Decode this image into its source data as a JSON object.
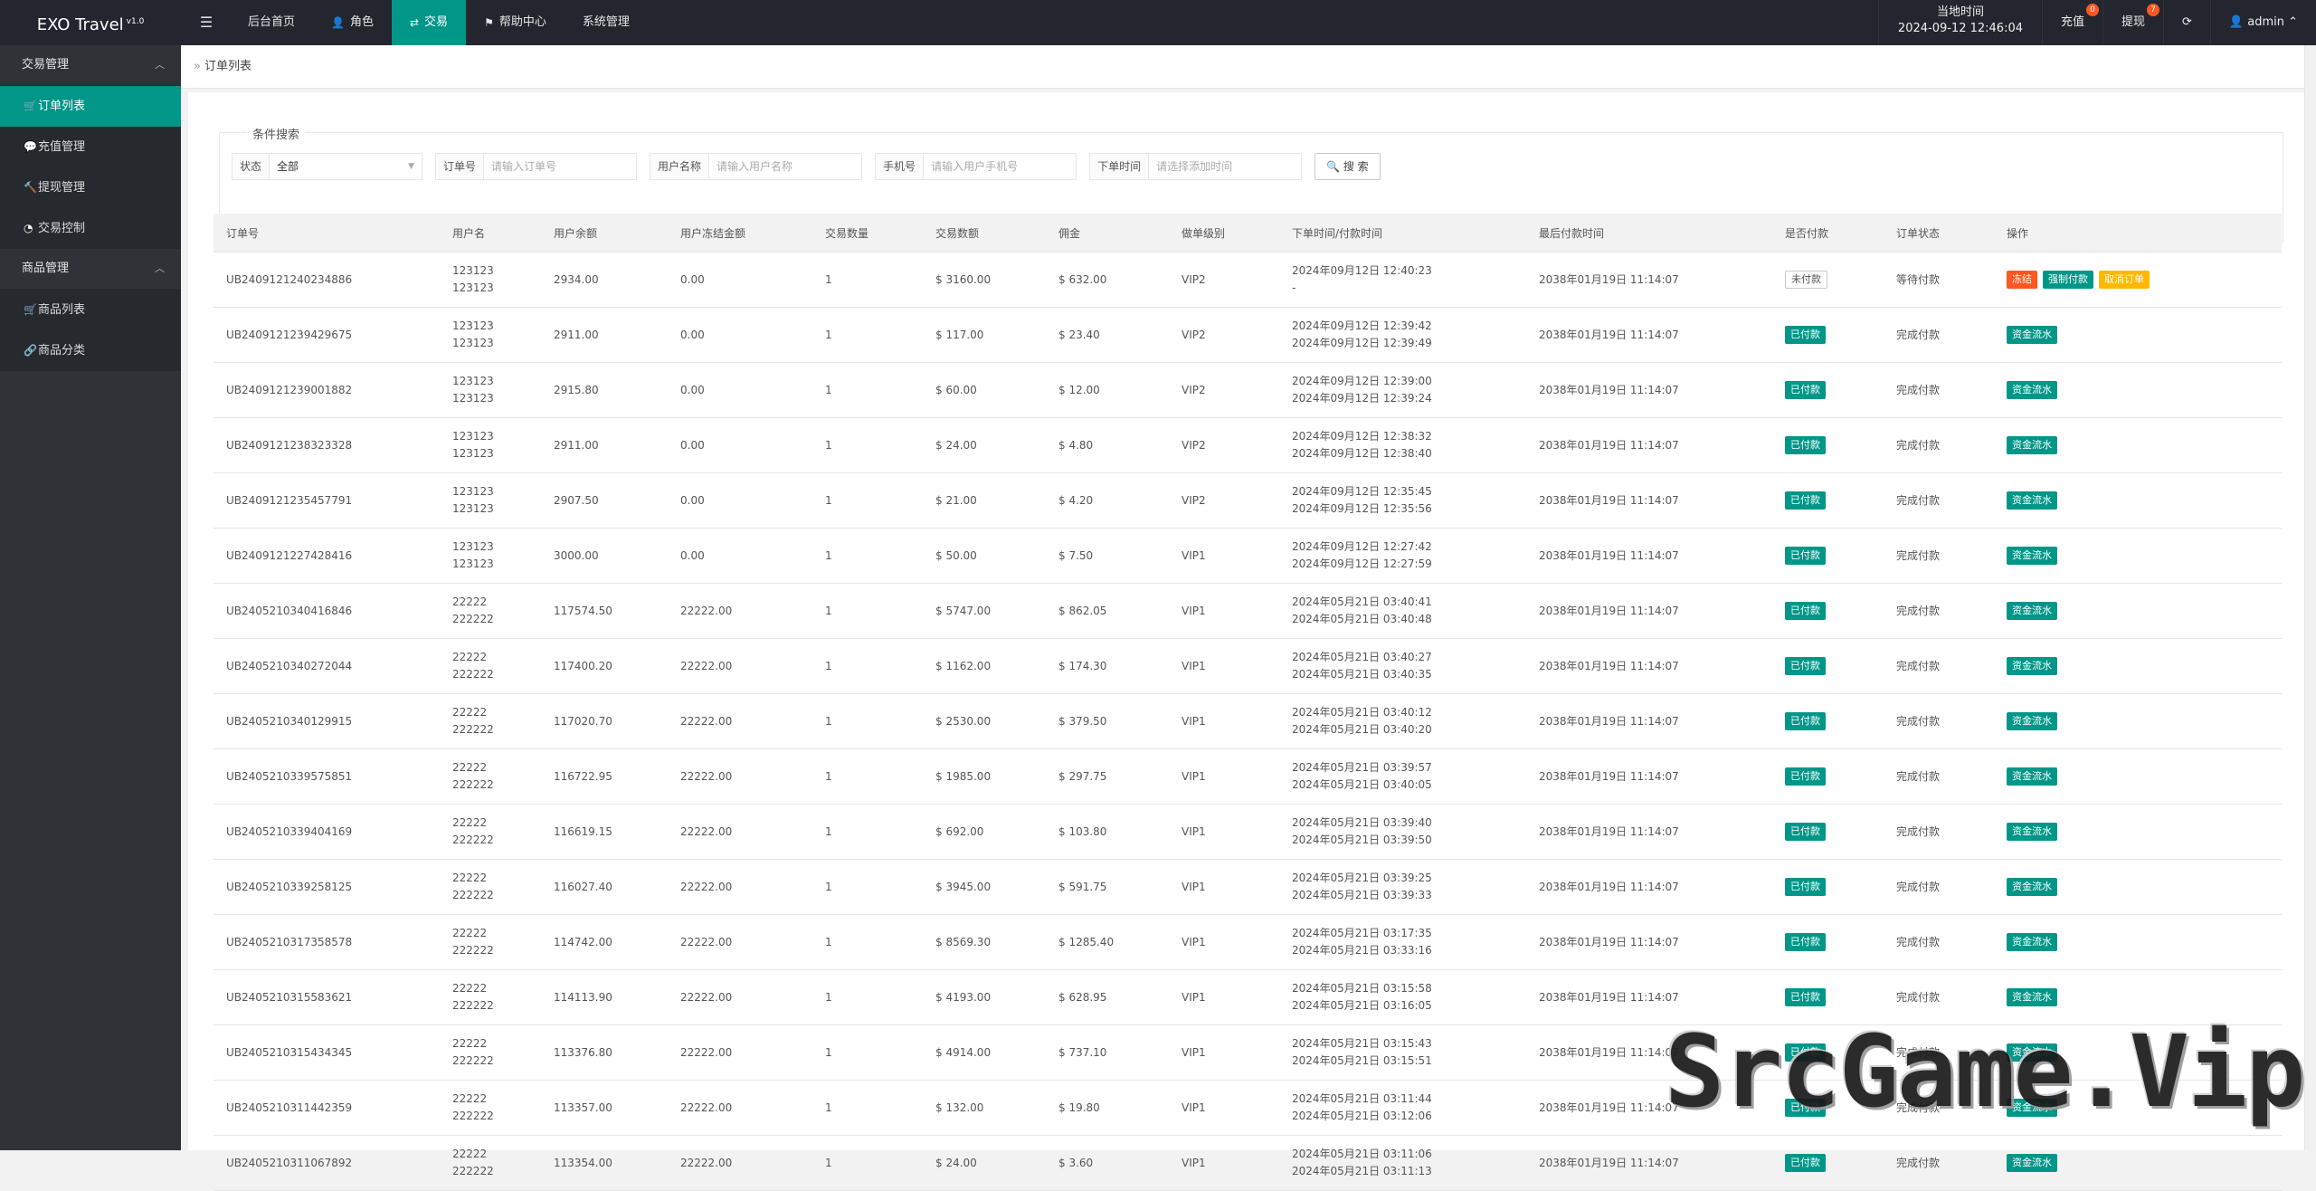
{
  "header": {
    "logo": "EXO Travel",
    "logo_version": "v1.0",
    "toggle_icon": "☰",
    "nav": [
      {
        "label": "后台首页",
        "icon": ""
      },
      {
        "label": "角色",
        "icon": "user-icon"
      },
      {
        "label": "交易",
        "icon": "exchange-icon"
      },
      {
        "label": "帮助中心",
        "icon": "flag-icon"
      },
      {
        "label": "系统管理",
        "icon": ""
      }
    ],
    "time_label": "当地时间",
    "time_value": "2024-09-12 12:46:04",
    "recharge": "充值",
    "recharge_badge": "0",
    "withdraw": "提现",
    "withdraw_badge": "7",
    "user": "admin"
  },
  "sidebar": {
    "group1": "交易管理",
    "group1_items": [
      "订单列表",
      "充值管理",
      "提现管理",
      "交易控制"
    ],
    "group2": "商品管理",
    "group2_items": [
      "商品列表",
      "商品分类"
    ]
  },
  "breadcrumb": "订单列表",
  "search": {
    "legend": "条件搜索",
    "status_label": "状态",
    "status_value": "全部",
    "order_label": "订单号",
    "order_placeholder": "请输入订单号",
    "user_label": "用户名称",
    "user_placeholder": "请输入用户名称",
    "phone_label": "手机号",
    "phone_placeholder": "请输入用户手机号",
    "time_label": "下单时间",
    "time_placeholder": "请选择添加时间",
    "button": "搜 索"
  },
  "table": {
    "headers": [
      "订单号",
      "用户名",
      "用户余额",
      "用户冻结金额",
      "交易数量",
      "交易数额",
      "佣金",
      "做单级别",
      "下单时间/付款时间",
      "最后付款时间",
      "是否付款",
      "订单状态",
      "操作"
    ],
    "rows": [
      [
        "UB2409121240234886",
        "123123",
        "123123",
        "2934.00",
        "0.00",
        "1",
        "$ 3160.00",
        "$ 632.00",
        "VIP2",
        "2024年09月12日 12:40:23",
        "-",
        "2038年01月19日 11:14:07",
        "未付款",
        "等待付款"
      ],
      [
        "UB2409121239429675",
        "123123",
        "123123",
        "2911.00",
        "0.00",
        "1",
        "$ 117.00",
        "$ 23.40",
        "VIP2",
        "2024年09月12日 12:39:42",
        "2024年09月12日 12:39:49",
        "2038年01月19日 11:14:07",
        "已付款",
        "完成付款"
      ],
      [
        "UB2409121239001882",
        "123123",
        "123123",
        "2915.80",
        "0.00",
        "1",
        "$ 60.00",
        "$ 12.00",
        "VIP2",
        "2024年09月12日 12:39:00",
        "2024年09月12日 12:39:24",
        "2038年01月19日 11:14:07",
        "已付款",
        "完成付款"
      ],
      [
        "UB2409121238323328",
        "123123",
        "123123",
        "2911.00",
        "0.00",
        "1",
        "$ 24.00",
        "$ 4.80",
        "VIP2",
        "2024年09月12日 12:38:32",
        "2024年09月12日 12:38:40",
        "2038年01月19日 11:14:07",
        "已付款",
        "完成付款"
      ],
      [
        "UB2409121235457791",
        "123123",
        "123123",
        "2907.50",
        "0.00",
        "1",
        "$ 21.00",
        "$ 4.20",
        "VIP2",
        "2024年09月12日 12:35:45",
        "2024年09月12日 12:35:56",
        "2038年01月19日 11:14:07",
        "已付款",
        "完成付款"
      ],
      [
        "UB2409121227428416",
        "123123",
        "123123",
        "3000.00",
        "0.00",
        "1",
        "$ 50.00",
        "$ 7.50",
        "VIP1",
        "2024年09月12日 12:27:42",
        "2024年09月12日 12:27:59",
        "2038年01月19日 11:14:07",
        "已付款",
        "完成付款"
      ],
      [
        "UB2405210340416846",
        "22222",
        "222222",
        "117574.50",
        "22222.00",
        "1",
        "$ 5747.00",
        "$ 862.05",
        "VIP1",
        "2024年05月21日 03:40:41",
        "2024年05月21日 03:40:48",
        "2038年01月19日 11:14:07",
        "已付款",
        "完成付款"
      ],
      [
        "UB2405210340272044",
        "22222",
        "222222",
        "117400.20",
        "22222.00",
        "1",
        "$ 1162.00",
        "$ 174.30",
        "VIP1",
        "2024年05月21日 03:40:27",
        "2024年05月21日 03:40:35",
        "2038年01月19日 11:14:07",
        "已付款",
        "完成付款"
      ],
      [
        "UB2405210340129915",
        "22222",
        "222222",
        "117020.70",
        "22222.00",
        "1",
        "$ 2530.00",
        "$ 379.50",
        "VIP1",
        "2024年05月21日 03:40:12",
        "2024年05月21日 03:40:20",
        "2038年01月19日 11:14:07",
        "已付款",
        "完成付款"
      ],
      [
        "UB2405210339575851",
        "22222",
        "222222",
        "116722.95",
        "22222.00",
        "1",
        "$ 1985.00",
        "$ 297.75",
        "VIP1",
        "2024年05月21日 03:39:57",
        "2024年05月21日 03:40:05",
        "2038年01月19日 11:14:07",
        "已付款",
        "完成付款"
      ],
      [
        "UB2405210339404169",
        "22222",
        "222222",
        "116619.15",
        "22222.00",
        "1",
        "$ 692.00",
        "$ 103.80",
        "VIP1",
        "2024年05月21日 03:39:40",
        "2024年05月21日 03:39:50",
        "2038年01月19日 11:14:07",
        "已付款",
        "完成付款"
      ],
      [
        "UB2405210339258125",
        "22222",
        "222222",
        "116027.40",
        "22222.00",
        "1",
        "$ 3945.00",
        "$ 591.75",
        "VIP1",
        "2024年05月21日 03:39:25",
        "2024年05月21日 03:39:33",
        "2038年01月19日 11:14:07",
        "已付款",
        "完成付款"
      ],
      [
        "UB2405210317358578",
        "22222",
        "222222",
        "114742.00",
        "22222.00",
        "1",
        "$ 8569.30",
        "$ 1285.40",
        "VIP1",
        "2024年05月21日 03:17:35",
        "2024年05月21日 03:33:16",
        "2038年01月19日 11:14:07",
        "已付款",
        "完成付款"
      ],
      [
        "UB2405210315583621",
        "22222",
        "222222",
        "114113.90",
        "22222.00",
        "1",
        "$ 4193.00",
        "$ 628.95",
        "VIP1",
        "2024年05月21日 03:15:58",
        "2024年05月21日 03:16:05",
        "2038年01月19日 11:14:07",
        "已付款",
        "完成付款"
      ],
      [
        "UB2405210315434345",
        "22222",
        "222222",
        "113376.80",
        "22222.00",
        "1",
        "$ 4914.00",
        "$ 737.10",
        "VIP1",
        "2024年05月21日 03:15:43",
        "2024年05月21日 03:15:51",
        "2038年01月19日 11:14:07",
        "已付款",
        "完成付款"
      ],
      [
        "UB2405210311442359",
        "22222",
        "222222",
        "113357.00",
        "22222.00",
        "1",
        "$ 132.00",
        "$ 19.80",
        "VIP1",
        "2024年05月21日 03:11:44",
        "2024年05月21日 03:12:06",
        "2038年01月19日 11:14:07",
        "已付款",
        "完成付款"
      ],
      [
        "UB2405210311067892",
        "22222",
        "222222",
        "113354.00",
        "22222.00",
        "1",
        "$ 24.00",
        "$ 3.60",
        "VIP1",
        "2024年05月21日 03:11:06",
        "2024年05月21日 03:11:13",
        "2038年01月19日 11:14:07",
        "已付款",
        "完成付款"
      ]
    ],
    "actions_unpaid": [
      "冻结",
      "强制付款",
      "取消订单"
    ],
    "actions_paid": [
      "资金流水"
    ]
  },
  "watermark": "SrcGame.Vip"
}
